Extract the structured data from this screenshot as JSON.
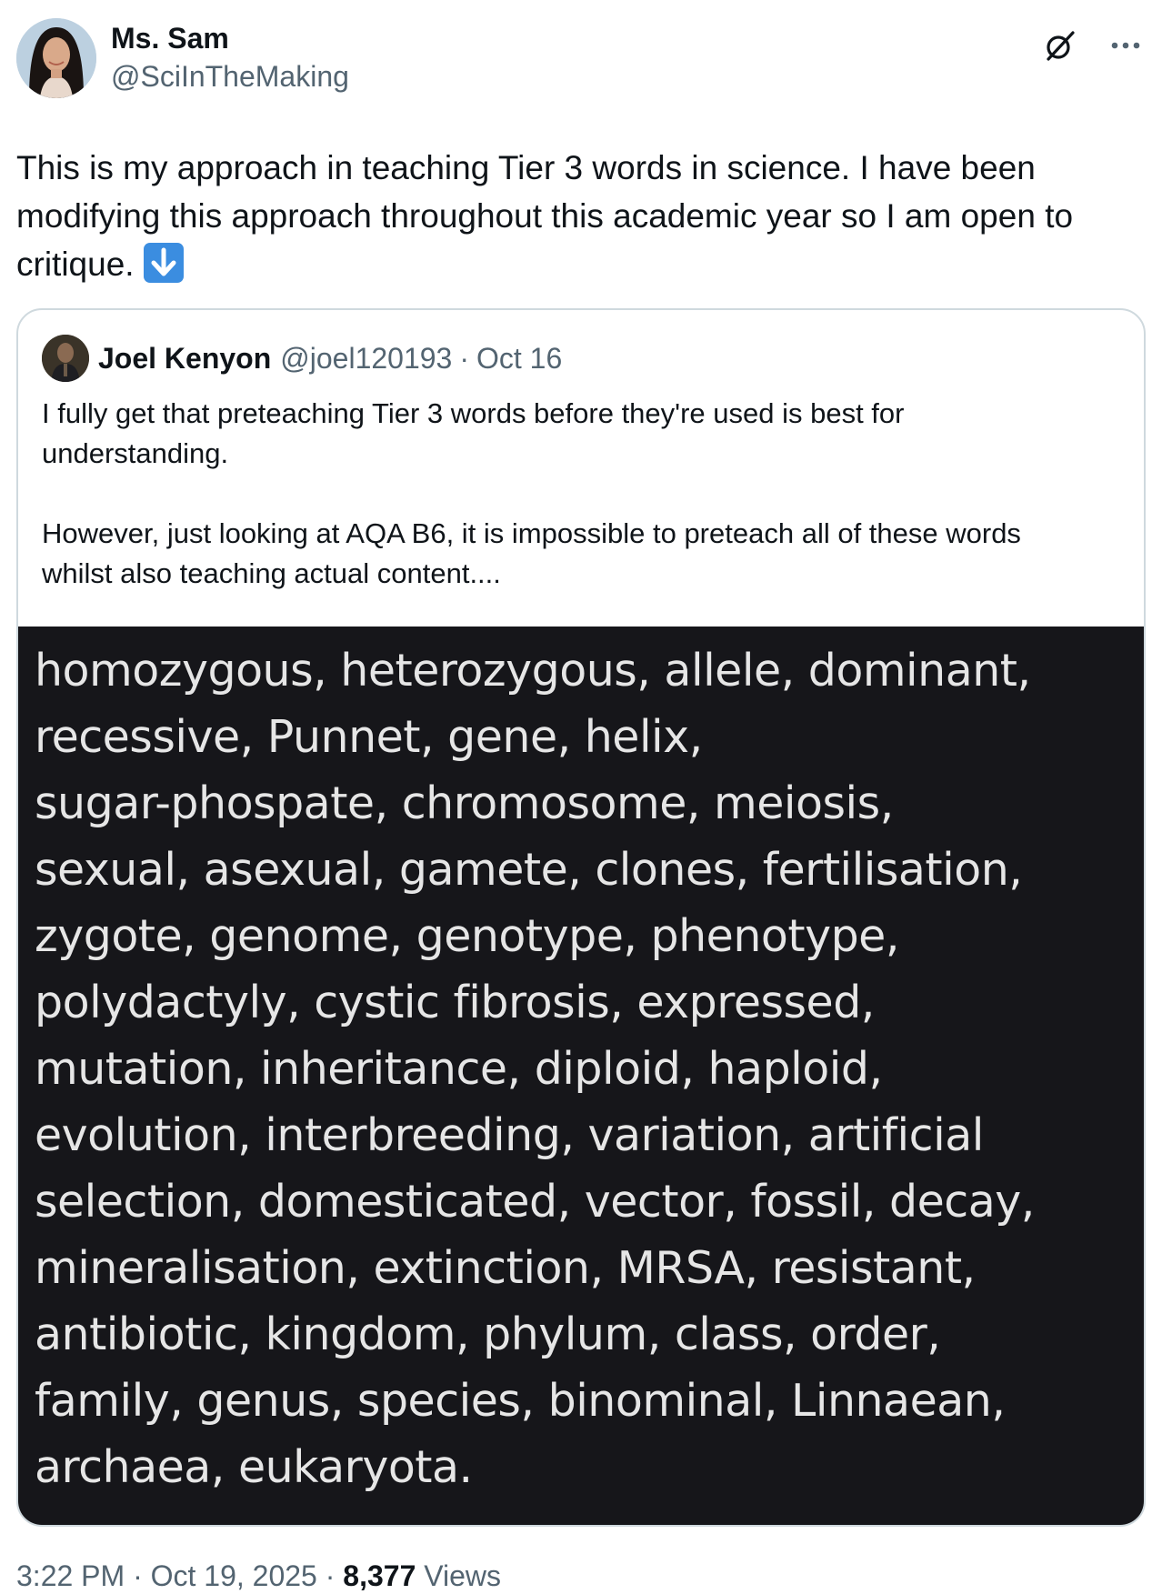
{
  "author": {
    "display_name": "Ms. Sam",
    "handle": "@SciInTheMaking"
  },
  "tweet": {
    "text_lines": [
      "This is my approach in teaching Tier 3 words in science. I have been",
      "modifying this approach throughout this academic year so I am open to",
      "critique."
    ],
    "emoji": "down-arrow-emoji"
  },
  "quoted": {
    "display_name": "Joel Kenyon",
    "handle": "@joel120193",
    "separator": "·",
    "date": "Oct 16",
    "paragraph1_lines": [
      "I fully get that preteaching Tier 3 words before they're used is best for",
      "understanding."
    ],
    "paragraph2_lines": [
      "However, just looking at AQA B6, it is impossible to preteach all of these words",
      "whilst also teaching actual content...."
    ],
    "image_text_lines": [
      "homozygous, heterozygous, allele, dominant,",
      "recessive, Punnet, gene, helix,",
      "sugar-phospate, chromosome, meiosis,",
      "sexual, asexual, gamete, clones, fertilisation,",
      "zygote, genome, genotype, phenotype,",
      "polydactyly, cystic fibrosis, expressed,",
      "mutation, inheritance, diploid, haploid,",
      "evolution, interbreeding, variation, artificial",
      "selection, domesticated, vector, fossil, decay,",
      "mineralisation, extinction, MRSA, resistant,",
      "antibiotic, kingdom, phylum, class, order,",
      "family, genus, species, binominal, Linnaean,",
      "archaea, eukaryota."
    ]
  },
  "meta": {
    "time": "3:22 PM",
    "separator": "·",
    "date": "Oct 19, 2025",
    "views_count": "8,377",
    "views_label": "Views"
  },
  "icons": {
    "grok": "grok-icon",
    "more": "more-icon"
  },
  "colors": {
    "text_primary": "#0f1419",
    "text_secondary": "#536471",
    "border": "#cfd9de",
    "image_bg": "#16161a",
    "emoji_bg": "#3b8de0"
  }
}
